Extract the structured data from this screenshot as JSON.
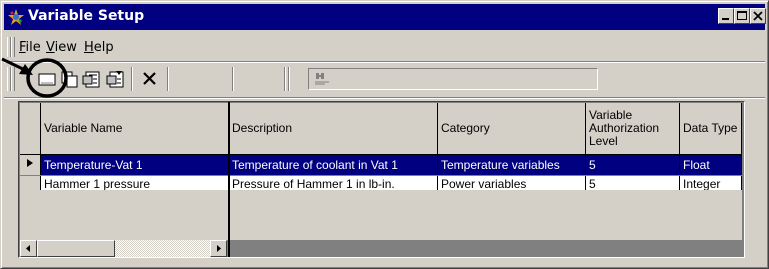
{
  "window": {
    "title": "Variable Setup",
    "controls": {
      "minimize": "minimize-icon",
      "maximize": "maximize-icon",
      "close": "close-icon"
    }
  },
  "menu": [
    {
      "label": "File",
      "accel": "F"
    },
    {
      "label": "View",
      "accel": "V"
    },
    {
      "label": "Help",
      "accel": "H"
    }
  ],
  "toolbar": {
    "buttons": [
      {
        "name": "new-icon"
      },
      {
        "name": "copy-icon"
      },
      {
        "name": "properties-icon"
      },
      {
        "name": "edit-properties-icon"
      },
      {
        "name": "delete-icon"
      }
    ],
    "find_icon": "find-icon",
    "find_value": ""
  },
  "grid": {
    "columns": [
      "Variable Name",
      "Description",
      "Category",
      "Variable Authorization Level",
      "Data Type"
    ],
    "rows": [
      [
        "Temperature-Vat 1",
        "Temperature of coolant in Vat 1",
        "Temperature variables",
        "5",
        "Float"
      ],
      [
        "Hammer 1 pressure",
        "Pressure of Hammer 1 in lb-in.",
        "Power variables",
        "5",
        "Integer"
      ]
    ],
    "selected_row": 0,
    "current_row_icon": "row-pointer-icon"
  },
  "colors": {
    "titlebar": "#000080",
    "selection": "#000080",
    "face": "#d4d0c8"
  },
  "annotation": {
    "callout": "arrow-circle-callout"
  }
}
